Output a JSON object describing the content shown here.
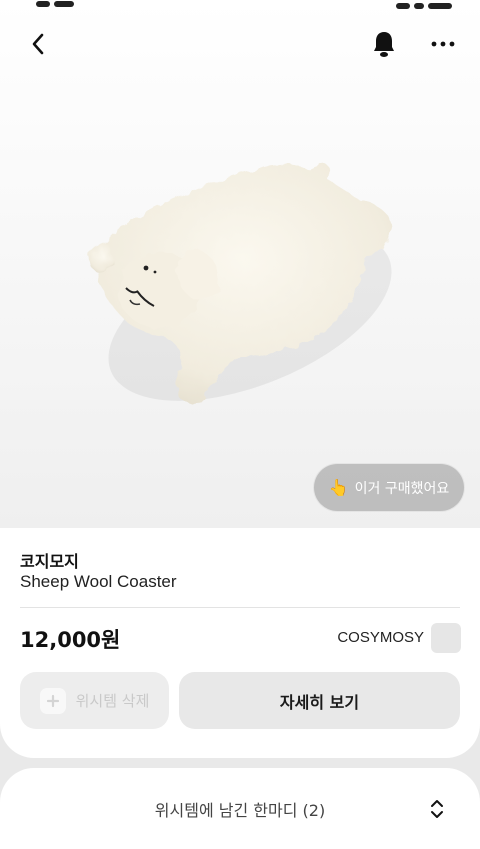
{
  "header": {
    "back_icon": "chevron-left-icon",
    "bell_icon": "bell-icon",
    "more_icon": "more-dots-icon"
  },
  "hero": {
    "image_label": "sheep-wool-coaster-image",
    "bought_button": "이거 구매했어요",
    "bought_icon": "pointing-hand-icon"
  },
  "product": {
    "brand_ko": "코지모지",
    "name": "Sheep Wool Coaster",
    "price": "12,000원",
    "brand_en": "COSYMOSY"
  },
  "actions": {
    "delete_label": "위시템 삭제",
    "detail_label": "자세히 보기"
  },
  "sheet": {
    "title": "위시템에 남긴 한마디 (2)",
    "toggle_icon": "expand-collapse-icon"
  },
  "colors": {
    "background": "#e9e9e9",
    "card": "#ffffff",
    "button_gray": "#e8e8e8",
    "overlay_button": "#969696"
  }
}
